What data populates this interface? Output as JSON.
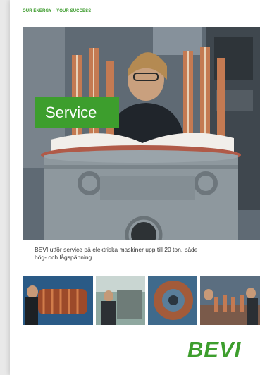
{
  "brochure": {
    "tagline": "OUR ENERGY – YOUR SUCCESS",
    "title": "Service",
    "description": "BEVI utför service på elektriska maskiner upp till 20 ton, både hög- och lågspänning.",
    "logo_text": "BEVI"
  },
  "colors": {
    "brand_green": "#3d9e2d",
    "tagline_green": "#3a9a2a",
    "background": "#e9e9e9"
  }
}
